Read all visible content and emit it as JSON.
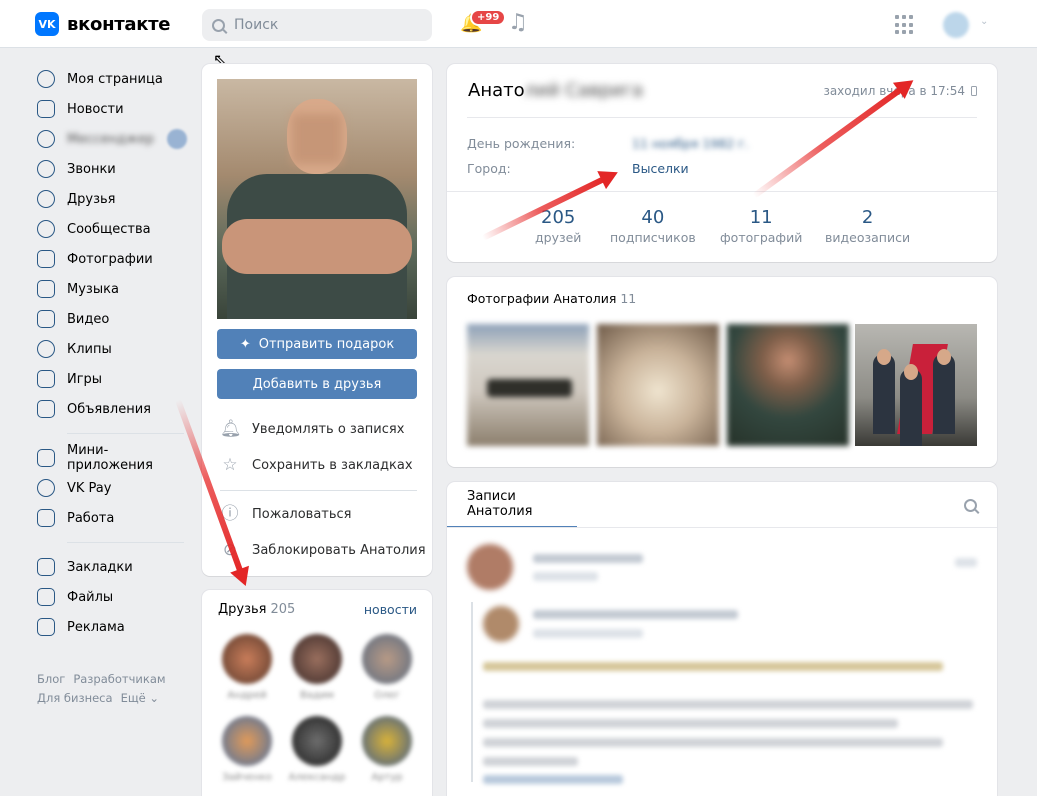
{
  "header": {
    "logo_text": "вконтакте",
    "logo_badge": "VK",
    "search_placeholder": "Поиск",
    "notifications_badge": "+99"
  },
  "menu": {
    "items": [
      {
        "label": "Моя страница",
        "icon": "user-circle-icon"
      },
      {
        "label": "Новости",
        "icon": "news-icon"
      },
      {
        "label": "Мессенджер",
        "icon": "message-icon"
      },
      {
        "label": "Звонки",
        "icon": "phone-icon"
      },
      {
        "label": "Друзья",
        "icon": "friends-icon"
      },
      {
        "label": "Сообщества",
        "icon": "communities-icon"
      },
      {
        "label": "Фотографии",
        "icon": "photos-icon"
      },
      {
        "label": "Музыка",
        "icon": "music-icon"
      },
      {
        "label": "Видео",
        "icon": "video-icon"
      },
      {
        "label": "Клипы",
        "icon": "clips-icon"
      },
      {
        "label": "Игры",
        "icon": "games-icon"
      },
      {
        "label": "Объявления",
        "icon": "ads-icon"
      }
    ],
    "items2": [
      {
        "label": "Мини-приложения",
        "icon": "mini-apps-icon"
      },
      {
        "label": "VK Pay",
        "icon": "vkpay-icon"
      },
      {
        "label": "Работа",
        "icon": "work-icon"
      }
    ],
    "items3": [
      {
        "label": "Закладки",
        "icon": "bookmarks-icon"
      },
      {
        "label": "Файлы",
        "icon": "files-icon"
      },
      {
        "label": "Реклама",
        "icon": "ad-icon"
      }
    ],
    "footer": [
      "Блог",
      "Разработчикам",
      "Для бизнеса",
      "Ещё ⌄"
    ]
  },
  "profile_actions": {
    "gift_button": "Отправить подарок",
    "add_friend_button": "Добавить в друзья",
    "notify": "Уведомлять о записях",
    "bookmark": "Сохранить в закладках",
    "report": "Пожаловаться",
    "block": "Заблокировать Анатолия"
  },
  "friends": {
    "title": "Друзья",
    "count": "205",
    "news_link": "новости",
    "names": [
      "Андрей",
      "Вадим",
      "Олег",
      "Зайченко",
      "Александр",
      "Артур"
    ]
  },
  "profile": {
    "name_visible": "Анато",
    "name_blurred": "лий Саврига",
    "last_seen": "заходил вчера в 17:54",
    "birthday_label": "День рождения:",
    "birthday_value": "11 ноября 1982 г.",
    "city_label": "Город:",
    "city_value": "Выселки",
    "counters": [
      {
        "num": "205",
        "label": "друзей"
      },
      {
        "num": "40",
        "label": "подписчиков"
      },
      {
        "num": "11",
        "label": "фотографий"
      },
      {
        "num": "2",
        "label": "видеозаписи"
      }
    ]
  },
  "photos": {
    "title": "Фотографии Анатолия",
    "count": "11"
  },
  "posts": {
    "tab": "Записи Анатолия"
  },
  "colors": {
    "accent": "#5181b8",
    "link": "#2a5885",
    "brand": "#0077ff",
    "badge": "#e64646"
  }
}
